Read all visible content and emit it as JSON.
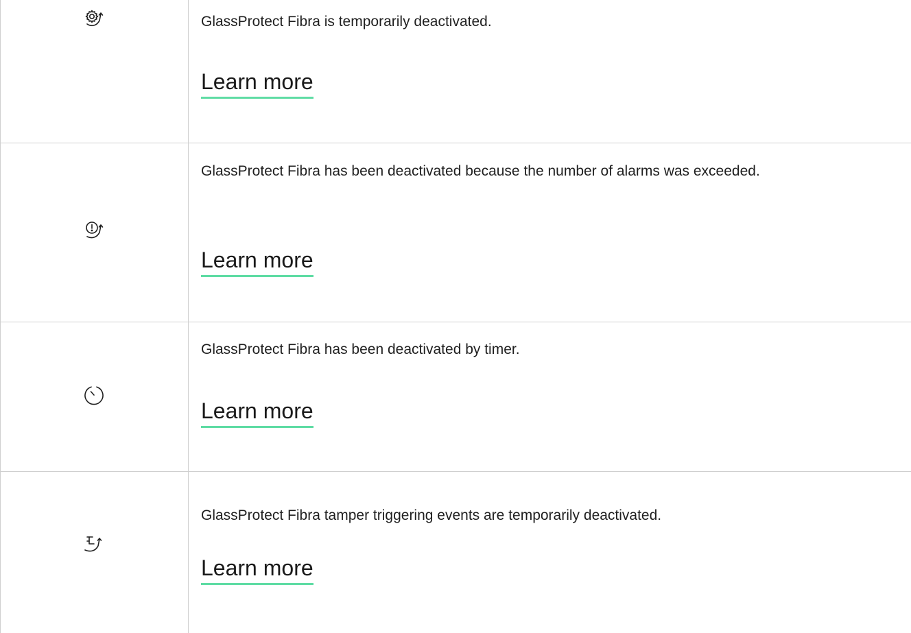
{
  "rows": [
    {
      "icon": "gear-arrow-icon",
      "description": "GlassProtect Fibra is temporarily deactivated.",
      "link_label": "Learn more"
    },
    {
      "icon": "alert-arrow-icon",
      "description": "GlassProtect Fibra has been deactivated because the number of alarms was exceeded.",
      "link_label": "Learn more"
    },
    {
      "icon": "timer-icon",
      "description": "GlassProtect Fibra has been deactivated by timer.",
      "link_label": "Learn more"
    },
    {
      "icon": "tamper-arrow-icon",
      "description": "GlassProtect Fibra tamper triggering events are temporarily deactivated.",
      "link_label": "Learn more"
    }
  ],
  "colors": {
    "link_underline": "#5fdca4",
    "border": "#cfcfcf",
    "text": "#1f1f1f"
  }
}
